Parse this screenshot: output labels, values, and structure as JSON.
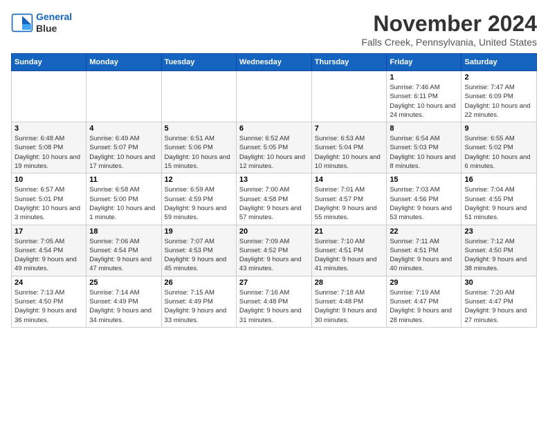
{
  "logo": {
    "line1": "General",
    "line2": "Blue"
  },
  "title": "November 2024",
  "location": "Falls Creek, Pennsylvania, United States",
  "days_of_week": [
    "Sunday",
    "Monday",
    "Tuesday",
    "Wednesday",
    "Thursday",
    "Friday",
    "Saturday"
  ],
  "weeks": [
    [
      {
        "day": "",
        "info": ""
      },
      {
        "day": "",
        "info": ""
      },
      {
        "day": "",
        "info": ""
      },
      {
        "day": "",
        "info": ""
      },
      {
        "day": "",
        "info": ""
      },
      {
        "day": "1",
        "info": "Sunrise: 7:46 AM\nSunset: 6:11 PM\nDaylight: 10 hours and 24 minutes."
      },
      {
        "day": "2",
        "info": "Sunrise: 7:47 AM\nSunset: 6:09 PM\nDaylight: 10 hours and 22 minutes."
      }
    ],
    [
      {
        "day": "3",
        "info": "Sunrise: 6:48 AM\nSunset: 5:08 PM\nDaylight: 10 hours and 19 minutes."
      },
      {
        "day": "4",
        "info": "Sunrise: 6:49 AM\nSunset: 5:07 PM\nDaylight: 10 hours and 17 minutes."
      },
      {
        "day": "5",
        "info": "Sunrise: 6:51 AM\nSunset: 5:06 PM\nDaylight: 10 hours and 15 minutes."
      },
      {
        "day": "6",
        "info": "Sunrise: 6:52 AM\nSunset: 5:05 PM\nDaylight: 10 hours and 12 minutes."
      },
      {
        "day": "7",
        "info": "Sunrise: 6:53 AM\nSunset: 5:04 PM\nDaylight: 10 hours and 10 minutes."
      },
      {
        "day": "8",
        "info": "Sunrise: 6:54 AM\nSunset: 5:03 PM\nDaylight: 10 hours and 8 minutes."
      },
      {
        "day": "9",
        "info": "Sunrise: 6:55 AM\nSunset: 5:02 PM\nDaylight: 10 hours and 6 minutes."
      }
    ],
    [
      {
        "day": "10",
        "info": "Sunrise: 6:57 AM\nSunset: 5:01 PM\nDaylight: 10 hours and 3 minutes."
      },
      {
        "day": "11",
        "info": "Sunrise: 6:58 AM\nSunset: 5:00 PM\nDaylight: 10 hours and 1 minute."
      },
      {
        "day": "12",
        "info": "Sunrise: 6:59 AM\nSunset: 4:59 PM\nDaylight: 9 hours and 59 minutes."
      },
      {
        "day": "13",
        "info": "Sunrise: 7:00 AM\nSunset: 4:58 PM\nDaylight: 9 hours and 57 minutes."
      },
      {
        "day": "14",
        "info": "Sunrise: 7:01 AM\nSunset: 4:57 PM\nDaylight: 9 hours and 55 minutes."
      },
      {
        "day": "15",
        "info": "Sunrise: 7:03 AM\nSunset: 4:56 PM\nDaylight: 9 hours and 53 minutes."
      },
      {
        "day": "16",
        "info": "Sunrise: 7:04 AM\nSunset: 4:55 PM\nDaylight: 9 hours and 51 minutes."
      }
    ],
    [
      {
        "day": "17",
        "info": "Sunrise: 7:05 AM\nSunset: 4:54 PM\nDaylight: 9 hours and 49 minutes."
      },
      {
        "day": "18",
        "info": "Sunrise: 7:06 AM\nSunset: 4:54 PM\nDaylight: 9 hours and 47 minutes."
      },
      {
        "day": "19",
        "info": "Sunrise: 7:07 AM\nSunset: 4:53 PM\nDaylight: 9 hours and 45 minutes."
      },
      {
        "day": "20",
        "info": "Sunrise: 7:09 AM\nSunset: 4:52 PM\nDaylight: 9 hours and 43 minutes."
      },
      {
        "day": "21",
        "info": "Sunrise: 7:10 AM\nSunset: 4:51 PM\nDaylight: 9 hours and 41 minutes."
      },
      {
        "day": "22",
        "info": "Sunrise: 7:11 AM\nSunset: 4:51 PM\nDaylight: 9 hours and 40 minutes."
      },
      {
        "day": "23",
        "info": "Sunrise: 7:12 AM\nSunset: 4:50 PM\nDaylight: 9 hours and 38 minutes."
      }
    ],
    [
      {
        "day": "24",
        "info": "Sunrise: 7:13 AM\nSunset: 4:50 PM\nDaylight: 9 hours and 36 minutes."
      },
      {
        "day": "25",
        "info": "Sunrise: 7:14 AM\nSunset: 4:49 PM\nDaylight: 9 hours and 34 minutes."
      },
      {
        "day": "26",
        "info": "Sunrise: 7:15 AM\nSunset: 4:49 PM\nDaylight: 9 hours and 33 minutes."
      },
      {
        "day": "27",
        "info": "Sunrise: 7:16 AM\nSunset: 4:48 PM\nDaylight: 9 hours and 31 minutes."
      },
      {
        "day": "28",
        "info": "Sunrise: 7:18 AM\nSunset: 4:48 PM\nDaylight: 9 hours and 30 minutes."
      },
      {
        "day": "29",
        "info": "Sunrise: 7:19 AM\nSunset: 4:47 PM\nDaylight: 9 hours and 28 minutes."
      },
      {
        "day": "30",
        "info": "Sunrise: 7:20 AM\nSunset: 4:47 PM\nDaylight: 9 hours and 27 minutes."
      }
    ]
  ]
}
